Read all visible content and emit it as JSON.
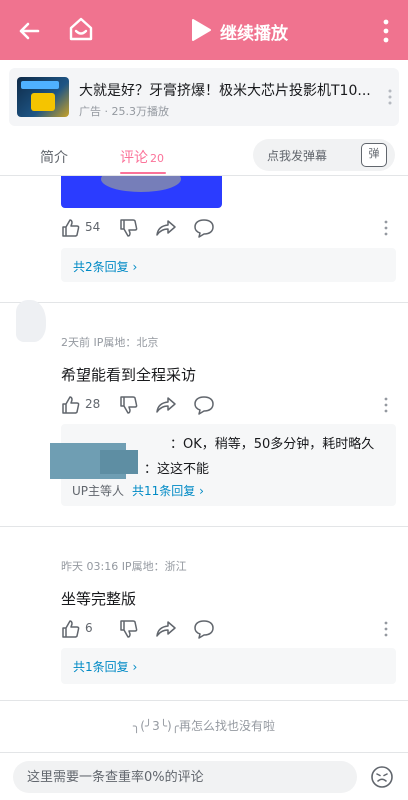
{
  "topbar": {
    "continue_label": "继续播放",
    "color": "#f0738f"
  },
  "ad": {
    "title": "大就是好？牙膏挤爆！极米大芯片投影机T10...",
    "meta": "广告 · 25.3万播放"
  },
  "tabs": {
    "intro": "简介",
    "comments": "评论",
    "comments_count": "20",
    "active_color": "#fb7299"
  },
  "danmaku": {
    "placeholder": "点我发弹幕",
    "button": "弹"
  },
  "comments": [
    {
      "likes": "54",
      "reply_link": "共2条回复"
    },
    {
      "meta": "2天前 IP属地：北京",
      "text": "希望能看到全程采访",
      "likes": "28",
      "reply_line1": "：OK，稍等，50多分钟，耗时略久",
      "reply_line2": "：这这不能",
      "up_tag": "UP主等人",
      "reply_link": "共11条回复"
    },
    {
      "meta": "昨天 03:16 IP属地：浙江",
      "text": "坐等完整版",
      "likes": "6",
      "reply_link": "共1条回复"
    }
  ],
  "end_text": "╮(╯3╰)╭再怎么找也没有啦",
  "bottom": {
    "input_placeholder": "这里需要一条查重率0%的评论"
  }
}
